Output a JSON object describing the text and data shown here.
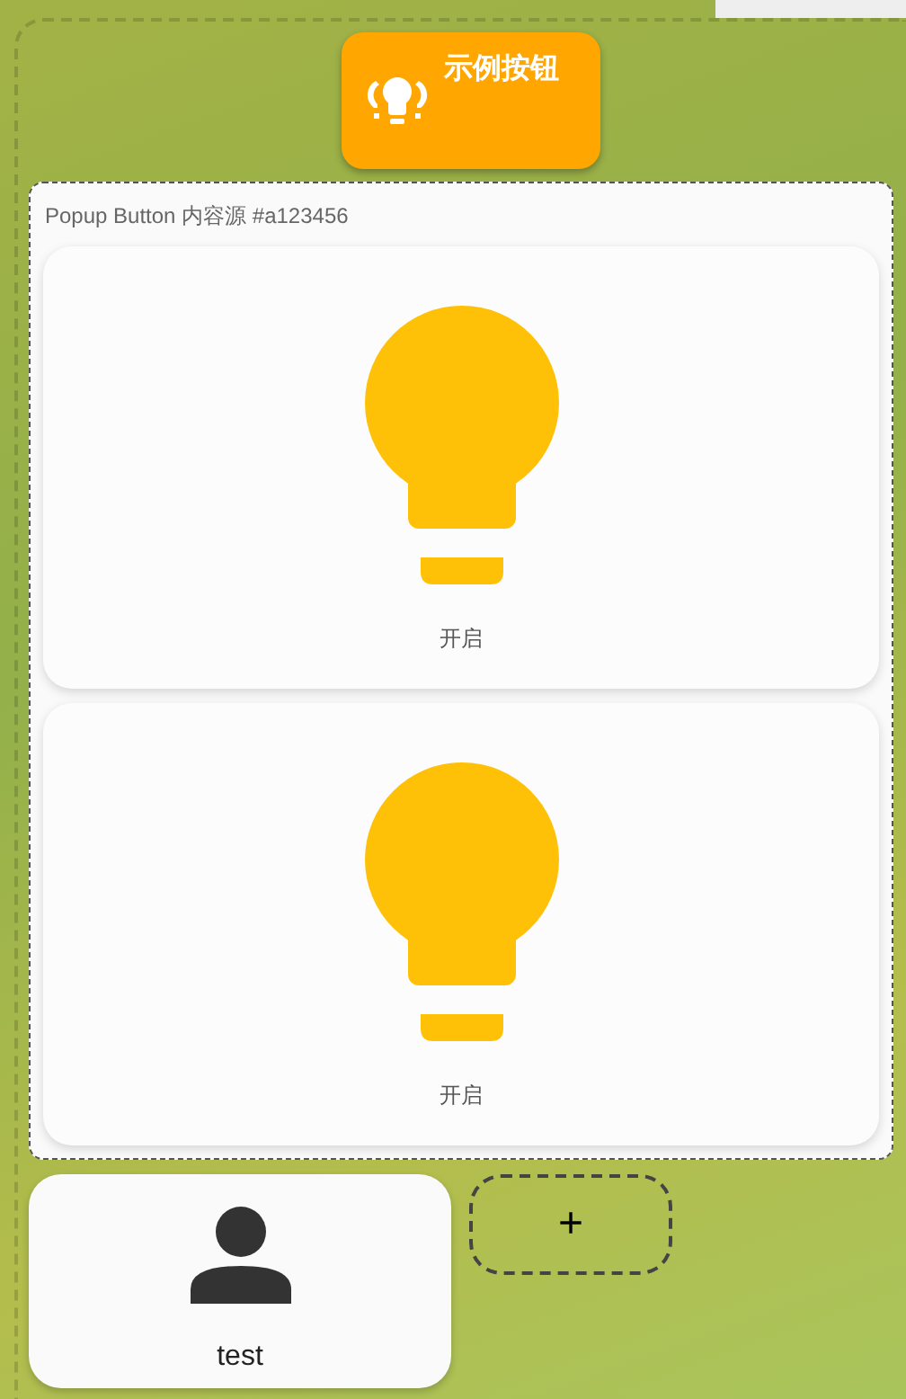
{
  "main_button": {
    "label": "示例按钮"
  },
  "popup": {
    "title": "Popup Button 内容源 #a123456",
    "cards": [
      {
        "label": "开启",
        "on": true
      },
      {
        "label": "开启",
        "on": true
      }
    ]
  },
  "person_card": {
    "name": "test"
  },
  "add_button": {
    "label": "+"
  }
}
